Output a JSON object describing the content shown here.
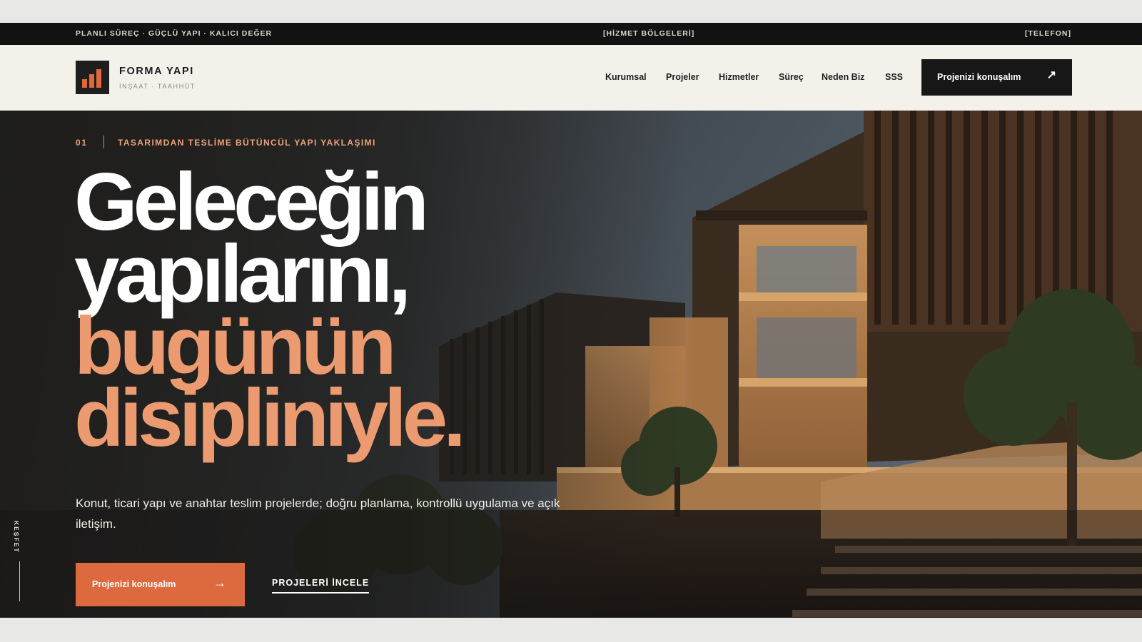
{
  "topbar": {
    "left": "PLANLI SÜREÇ · GÜÇLÜ YAPI · KALICI DEĞER",
    "center": "[HİZMET BÖLGELERİ]",
    "right": "[TELEFON]"
  },
  "header": {
    "logo_icon": "bar-chart-icon",
    "brand": "FORMA YAPI",
    "tagline": "İNŞAAT · TAAHHÜT",
    "nav": [
      "Kurumsal",
      "Projeler",
      "Hizmetler",
      "Süreç",
      "Neden Biz",
      "SSS"
    ],
    "cta_label": "Projenizi konuşalım",
    "cta_icon": "arrow-up-right-icon"
  },
  "hero": {
    "eyebrow_number": "01",
    "eyebrow_text": "TASARIMDAN TESLİME BÜTÜNCÜL YAPI YAKLAŞIMI",
    "headline_lines": [
      "Geleceğin",
      "yapılarını,",
      "bugünün",
      "disipliniyle."
    ],
    "lead": "Konut, ticari yapı ve anahtar teslim projelerde; doğru planlama, kontrollü uygulama ve açık iletişim.",
    "primary_button": "Projenizi konuşalım",
    "primary_icon": "arrow-right-icon",
    "secondary_link": "PROJELERİ İNCELE",
    "side_label": "KEŞFET",
    "background_image": "modern-house-sunset-photo"
  },
  "colors": {
    "accent": "#dd6a3e",
    "headline_accent": "#ec9a70",
    "dark": "#121212",
    "header_bg": "#f3f1ea"
  }
}
